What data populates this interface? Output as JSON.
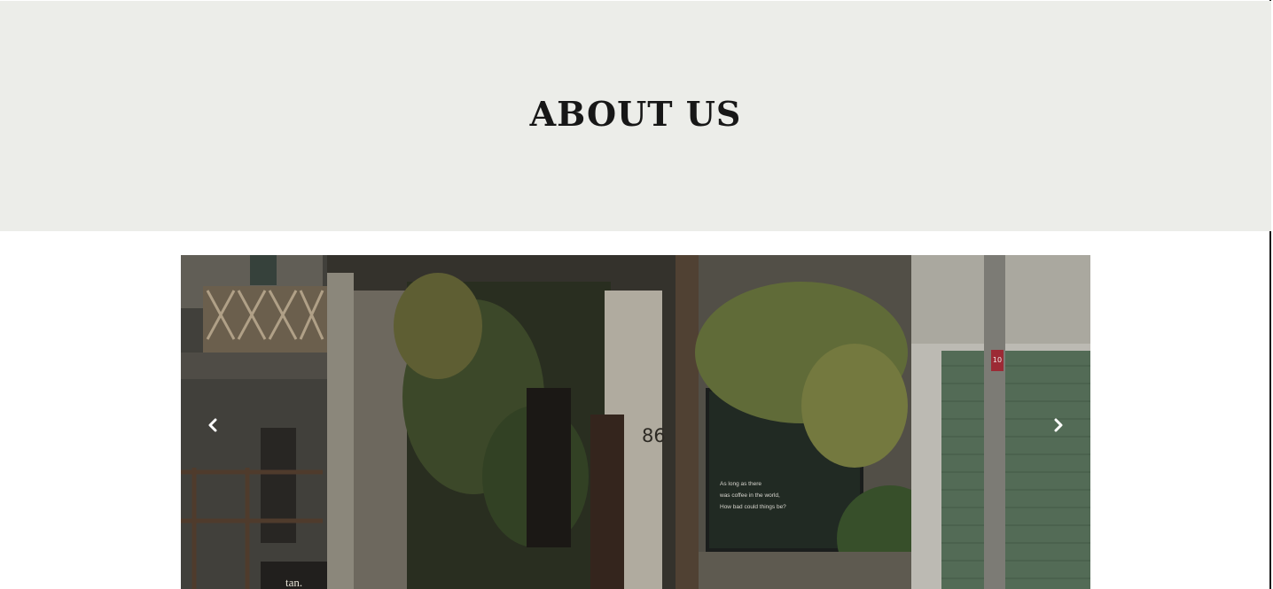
{
  "hero": {
    "title": "ABOUT US"
  },
  "carousel": {
    "prev_icon": "chevron-left-icon",
    "next_icon": "chevron-right-icon",
    "slide": {
      "sign_text": "tan.",
      "house_number": "86",
      "window_quote": [
        "As long as there",
        "was coffee in the world,",
        "How bad could things be?"
      ],
      "pole_tag": "10"
    }
  },
  "colors": {
    "hero_background": "#ecede9",
    "title_text": "#171717",
    "arrow": "#ffffff"
  }
}
